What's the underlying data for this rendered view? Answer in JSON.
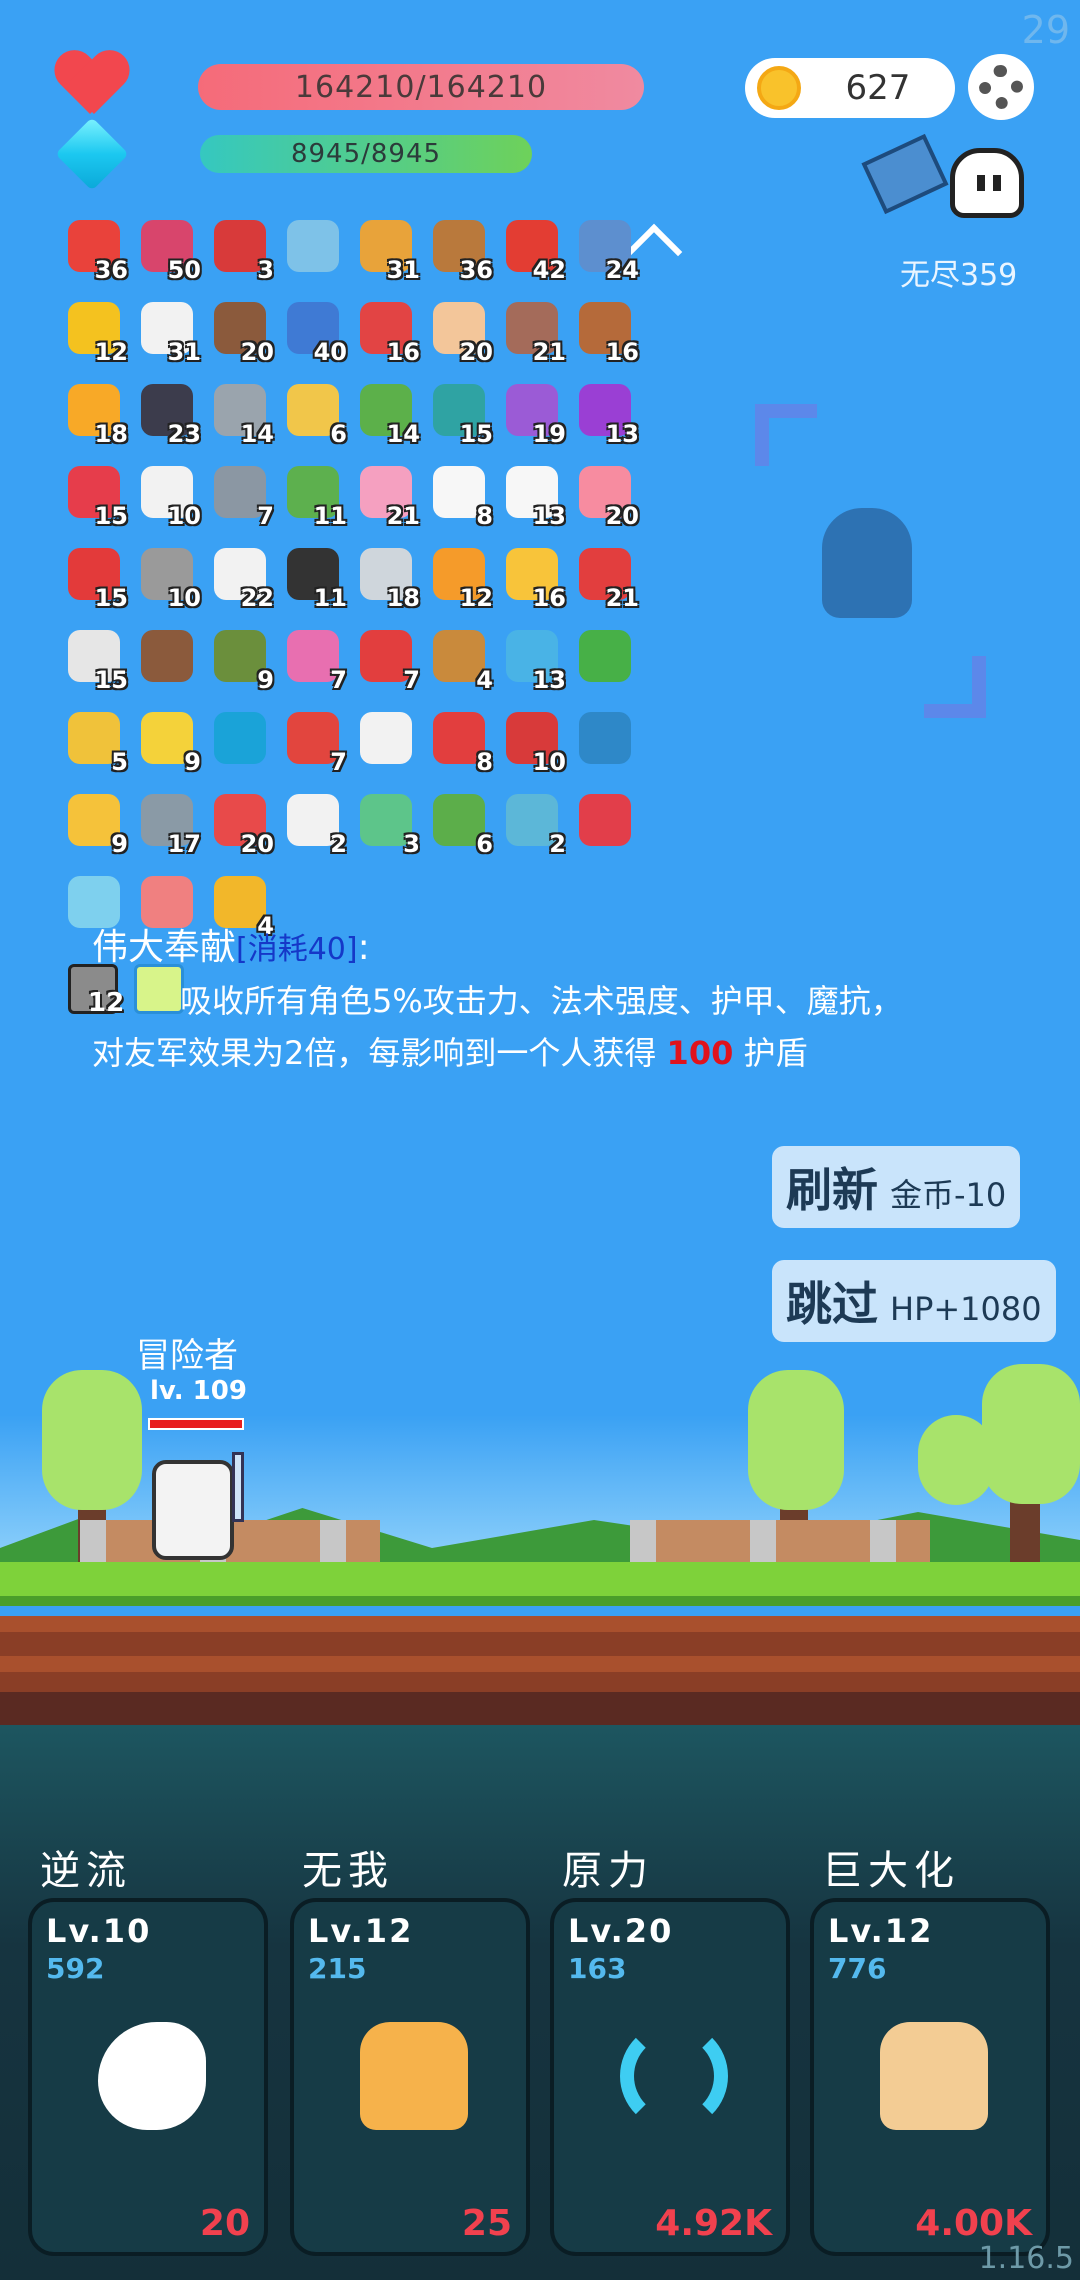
{
  "corner_number": "29",
  "status": {
    "hp": "164210/164210",
    "mp": "8945/8945"
  },
  "currency": {
    "coins": "627"
  },
  "mode": {
    "label": "无尽359"
  },
  "items": [
    {
      "count": "36",
      "color": "#e9423b"
    },
    {
      "count": "50",
      "color": "#d8456c"
    },
    {
      "count": "3",
      "color": "#d83a3a"
    },
    {
      "count": "",
      "color": "#7ec2e8"
    },
    {
      "count": "31",
      "color": "#e8a33a"
    },
    {
      "count": "36",
      "color": "#b9793c"
    },
    {
      "count": "42",
      "color": "#e33d33"
    },
    {
      "count": "24",
      "color": "#5d8fcf"
    },
    {
      "count": "12",
      "color": "#f4c21f"
    },
    {
      "count": "31",
      "color": "#f2f2f2"
    },
    {
      "count": "20",
      "color": "#8b5a3c"
    },
    {
      "count": "40",
      "color": "#3f7ad4"
    },
    {
      "count": "16",
      "color": "#e24444"
    },
    {
      "count": "20",
      "color": "#f3c69a"
    },
    {
      "count": "21",
      "color": "#a46b5a"
    },
    {
      "count": "16",
      "color": "#b56a3a"
    },
    {
      "count": "18",
      "color": "#f8a927"
    },
    {
      "count": "23",
      "color": "#3c3c4c"
    },
    {
      "count": "14",
      "color": "#9aa4ad"
    },
    {
      "count": "6",
      "color": "#f1c64a"
    },
    {
      "count": "14",
      "color": "#5cb04a"
    },
    {
      "count": "15",
      "color": "#2fa3a3"
    },
    {
      "count": "19",
      "color": "#9b5bd6"
    },
    {
      "count": "13",
      "color": "#9a3fd4"
    },
    {
      "count": "15",
      "color": "#e63d4b"
    },
    {
      "count": "10",
      "color": "#f2f2f2"
    },
    {
      "count": "7",
      "color": "#8b97a3"
    },
    {
      "count": "11",
      "color": "#5db04e"
    },
    {
      "count": "21",
      "color": "#f5a0c0"
    },
    {
      "count": "8",
      "color": "#f7f7f7"
    },
    {
      "count": "13",
      "color": "#f7f7f7"
    },
    {
      "count": "20",
      "color": "#f78ca0"
    },
    {
      "count": "15",
      "color": "#e33a3a"
    },
    {
      "count": "10",
      "color": "#9a9a9a"
    },
    {
      "count": "22",
      "color": "#f2f2f2"
    },
    {
      "count": "11",
      "color": "#333333"
    },
    {
      "count": "18",
      "color": "#cfd6dc"
    },
    {
      "count": "12",
      "color": "#f59b2a"
    },
    {
      "count": "16",
      "color": "#f8c43a"
    },
    {
      "count": "21",
      "color": "#e23e3e"
    },
    {
      "count": "15",
      "color": "#e6e6e6"
    },
    {
      "count": "",
      "color": "#8b5a3c"
    },
    {
      "count": "9",
      "color": "#6b8f3c"
    },
    {
      "count": "7",
      "color": "#e86fb0"
    },
    {
      "count": "7",
      "color": "#e23e3e"
    },
    {
      "count": "4",
      "color": "#c98a3c"
    },
    {
      "count": "13",
      "color": "#49b3e6"
    },
    {
      "count": "",
      "color": "#47b047"
    },
    {
      "count": "5",
      "color": "#f0c23a"
    },
    {
      "count": "9",
      "color": "#f4d23a"
    },
    {
      "count": "",
      "color": "#1aa3d8"
    },
    {
      "count": "7",
      "color": "#e2453e"
    },
    {
      "count": "",
      "color": "#f2f2f2"
    },
    {
      "count": "8",
      "color": "#e23e3e"
    },
    {
      "count": "10",
      "color": "#d83a3a"
    },
    {
      "count": "",
      "color": "#2e88c8"
    },
    {
      "count": "9",
      "color": "#f5c23a"
    },
    {
      "count": "17",
      "color": "#8a9aa6"
    },
    {
      "count": "20",
      "color": "#e84a4a"
    },
    {
      "count": "2",
      "color": "#f2f2f2"
    },
    {
      "count": "3",
      "color": "#5dc58a"
    },
    {
      "count": "6",
      "color": "#5cae4a"
    },
    {
      "count": "2",
      "color": "#5cb7d8"
    },
    {
      "count": "",
      "color": "#e23e4a"
    },
    {
      "count": "",
      "color": "#7ed0ee"
    },
    {
      "count": "",
      "color": "#f08080"
    },
    {
      "count": "4",
      "color": "#f2b72a"
    }
  ],
  "description": {
    "title": "伟大奉献",
    "cost": "[消耗40]",
    "colon": ":",
    "icon_count": "12",
    "line1": "吸收所有角色5%攻击力、法术强度、护甲、魔抗，",
    "line2_a": "对友军效果为2倍，每影响到一个人获得",
    "line2_value": "100",
    "line2_b": "护盾"
  },
  "buttons": {
    "refresh_big": "刷新",
    "refresh_small": "金币-10",
    "skip_big": "跳过",
    "skip_small": "HP+1080"
  },
  "hero": {
    "name": "冒险者",
    "level": "lv. 109"
  },
  "skills": [
    {
      "title": "逆流",
      "level": "Lv.10",
      "value": "592",
      "cost": "20",
      "icon": "wing-icon",
      "color": "#ffffff"
    },
    {
      "title": "无我",
      "level": "Lv.12",
      "value": "215",
      "cost": "25",
      "icon": "palm-eye-icon",
      "color": "#f6b24b"
    },
    {
      "title": "原力",
      "level": "Lv.20",
      "value": "163",
      "cost": "4.92K",
      "icon": "cycle-icon",
      "color": "#3ecdf2"
    },
    {
      "title": "巨大化",
      "level": "Lv.12",
      "value": "776",
      "cost": "4.00K",
      "icon": "fist-icon",
      "color": "#f3cc94"
    }
  ],
  "version": "1.16.5"
}
